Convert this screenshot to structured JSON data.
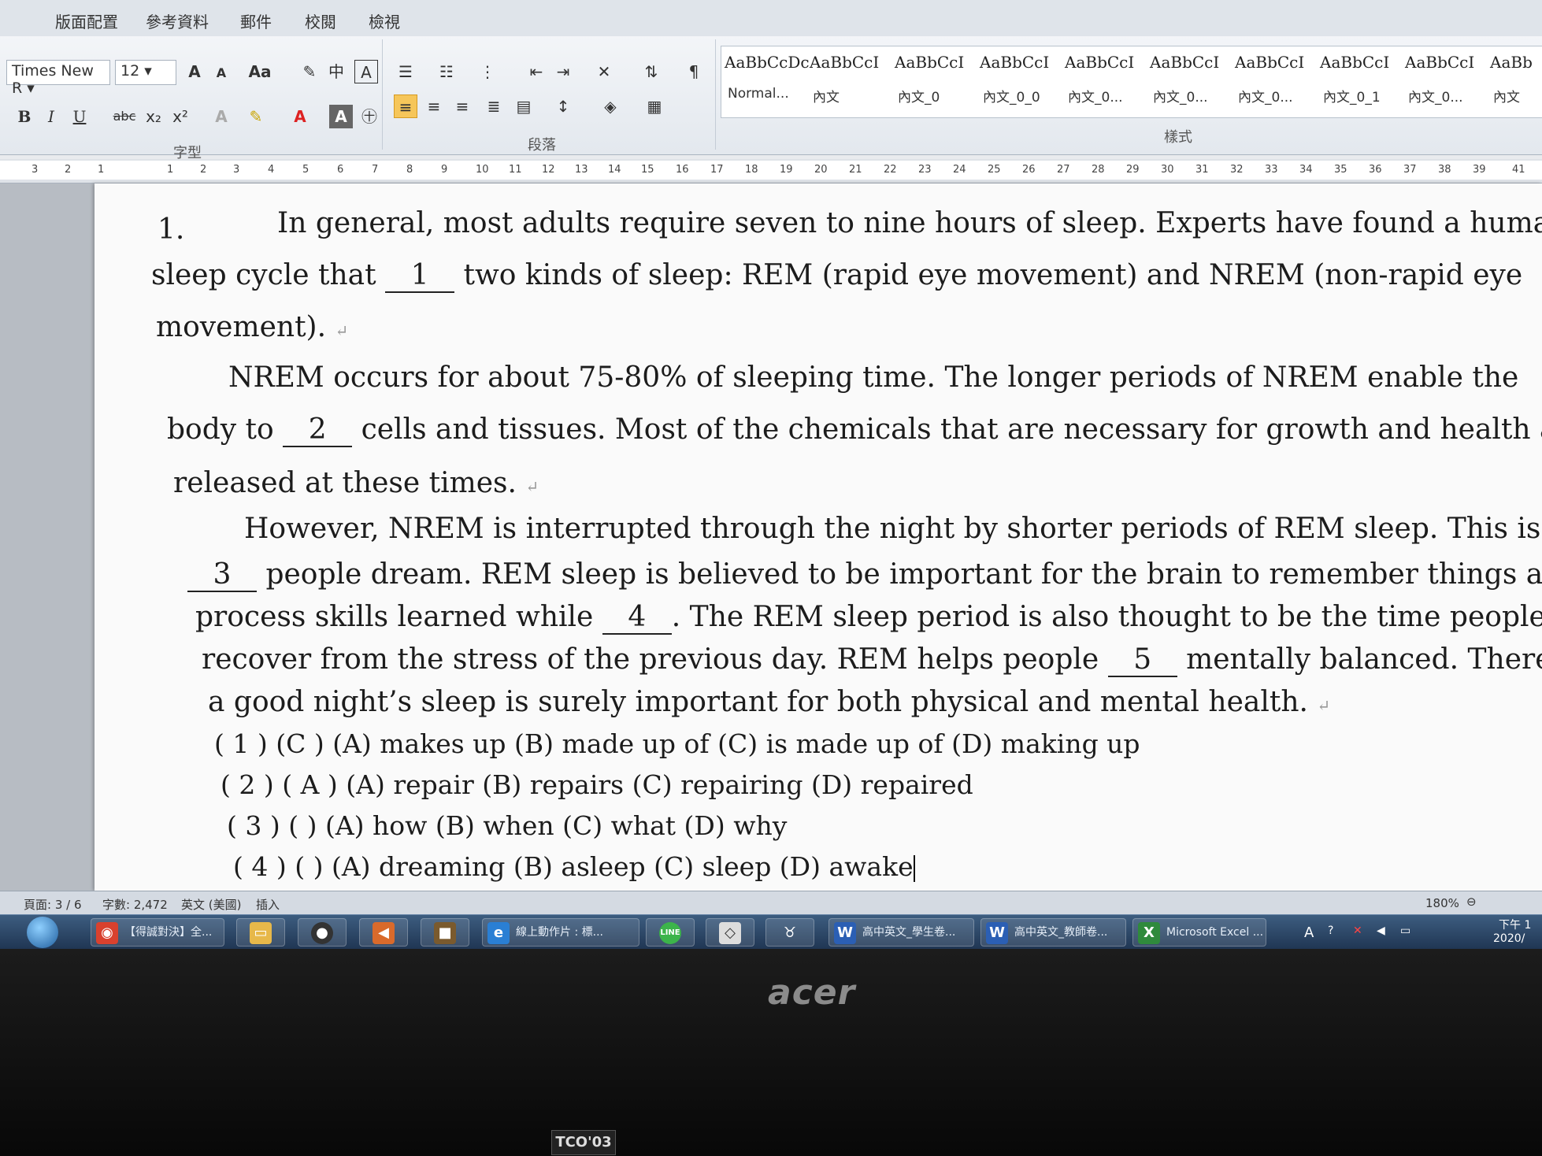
{
  "ribbon_tabs": [
    "版面配置",
    "參考資料",
    "郵件",
    "校閱",
    "檢視"
  ],
  "font": {
    "name": "Times New R",
    "size": "12",
    "grow": "A",
    "shrink": "A",
    "case": "Aa",
    "phonetic": "中",
    "border_char": "A"
  },
  "format_buttons": {
    "bold": "B",
    "italic": "I",
    "underline": "U",
    "strike": "abc",
    "subscript": "x₂",
    "superscript": "x²"
  },
  "group_labels": {
    "font": "字型",
    "paragraph": "段落",
    "styles": "樣式"
  },
  "styles": [
    {
      "sample": "AaBbCcDc",
      "name": "Normal..."
    },
    {
      "sample": "AaBbCcI",
      "name": "內文"
    },
    {
      "sample": "AaBbCcI",
      "name": "內文_0"
    },
    {
      "sample": "AaBbCcI",
      "name": "內文_0_0"
    },
    {
      "sample": "AaBbCcI",
      "name": "內文_0..."
    },
    {
      "sample": "AaBbCcI",
      "name": "內文_0..."
    },
    {
      "sample": "AaBbCcI",
      "name": "內文_0..."
    },
    {
      "sample": "AaBbCcI",
      "name": "內文_0_1"
    },
    {
      "sample": "AaBbCcI",
      "name": "內文_0..."
    },
    {
      "sample": "AaBb",
      "name": "內文"
    }
  ],
  "ruler_numbers": [
    "3",
    "2",
    "1",
    "1",
    "2",
    "3",
    "4",
    "5",
    "6",
    "7",
    "8",
    "9",
    "10",
    "11",
    "12",
    "13",
    "14",
    "15",
    "16",
    "17",
    "18",
    "19",
    "20",
    "21",
    "22",
    "23",
    "24",
    "25",
    "26",
    "27",
    "28",
    "29",
    "30",
    "31",
    "32",
    "33",
    "34",
    "35",
    "36",
    "37",
    "38",
    "39",
    "41"
  ],
  "document": {
    "number": "1.",
    "p1_a": "In general, most adults require seven to nine hours of sleep. Experts have found a human",
    "p1_b1": "sleep cycle that",
    "blank1": "1",
    "p1_b2": "two kinds of sleep: REM (rapid eye movement) and NREM (non-rapid eye",
    "p1_c": "movement).",
    "p2_a": "NREM occurs for about 75-80% of sleeping time. The longer periods of NREM enable the",
    "p2_b1": "body to",
    "blank2": "2",
    "p2_b2": "cells and tissues. Most of the chemicals that are necessary for growth and health are",
    "p2_c": "released at these times.",
    "p3_a": "However, NREM is interrupted through the night by shorter periods of REM sleep. This is",
    "blank3": "3",
    "p3_b2": "people dream. REM sleep is believed to be important for the brain to remember things and to",
    "p3_c1": "process skills learned while",
    "blank4": "4",
    "p3_c2": ". The REM sleep period is also thought to be the time people",
    "p3_d1": "recover from the stress of the previous day. REM helps people",
    "blank5": "5",
    "p3_d2": "mentally balanced. Therefore,",
    "p3_e": "a good night’s sleep is surely important for both physical and mental health.",
    "q1": "( 1 ) (C    ) (A) makes up (B) made up of (C) is made up of (D) making up",
    "q2": "( 2 ) ( A ) (A) repair (B) repairs (C) repairing (D) repaired",
    "q3": "( 3 ) (    ) (A) how (B) when (C) what (D) why",
    "q4": "( 4 ) (    ) (A) dreaming (B) asleep (C) sleep (D) awake"
  },
  "status": {
    "page": "頁面: 3 / 6",
    "words": "字數: 2,472",
    "lang": "英文 (美國)",
    "mode": "插入",
    "zoom": "180%"
  },
  "taskbar": {
    "chrome": "【得誠對決】全...",
    "ie": "線上動作片 : 標...",
    "word1": "高中英文_學生卷...",
    "word2": "高中英文_教師卷...",
    "excel": "Microsoft Excel ...",
    "ime": "A",
    "time": "下午 1",
    "date": "2020/"
  },
  "monitor": {
    "brand": "acer",
    "badge": "TCO'03"
  },
  "colors": {
    "active_button": "#f6c65a",
    "taskbar": "#1f3552"
  }
}
